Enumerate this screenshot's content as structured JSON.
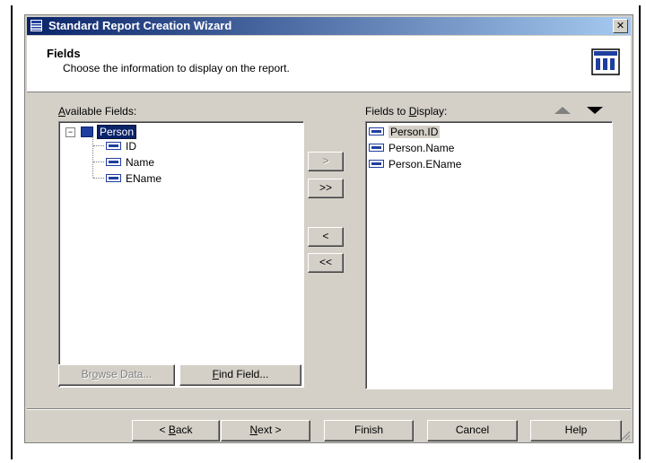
{
  "window": {
    "title": "Standard Report Creation Wizard",
    "close_label": "✕"
  },
  "header": {
    "title": "Fields",
    "subtitle": "Choose the information to display on the report."
  },
  "available": {
    "label_prefix": "A",
    "label_rest": "vailable Fields:",
    "root": "Person",
    "expander": "−",
    "children": [
      "ID",
      "Name",
      "EName"
    ]
  },
  "display": {
    "label_start": "Fields to ",
    "label_mnemonic": "D",
    "label_end": "isplay:",
    "items": [
      "Person.ID",
      "Person.Name",
      "Person.EName"
    ]
  },
  "transfer": {
    "add_one": ">",
    "add_all": ">>",
    "remove_one": "<",
    "remove_all": "<<"
  },
  "left_buttons": {
    "browse_a": "Br",
    "browse_mn": "o",
    "browse_b": "wse Data...",
    "find_mn": "F",
    "find_b": "ind Field..."
  },
  "footer": {
    "back_a": "< ",
    "back_mn": "B",
    "back_b": "ack",
    "next_mn": "N",
    "next_b": "ext >",
    "finish": "Finish",
    "cancel": "Cancel",
    "help": "Help"
  }
}
